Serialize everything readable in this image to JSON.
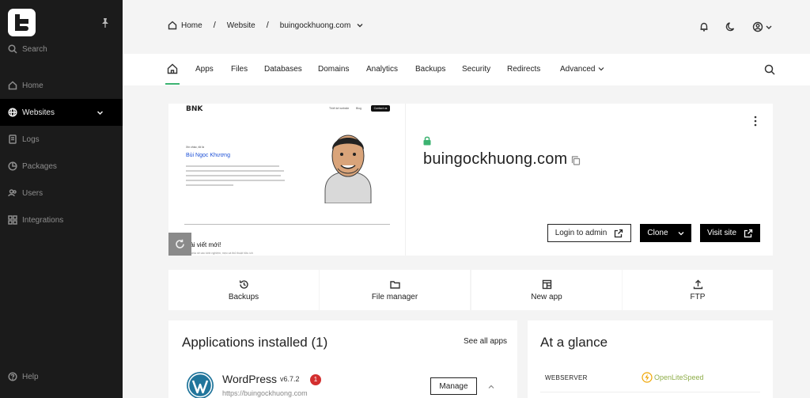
{
  "sidebar": {
    "search_label": "Search",
    "items": [
      {
        "label": "Home"
      },
      {
        "label": "Websites"
      },
      {
        "label": "Logs"
      },
      {
        "label": "Packages"
      },
      {
        "label": "Users"
      },
      {
        "label": "Integrations"
      }
    ],
    "help_label": "Help"
  },
  "breadcrumb": {
    "home": "Home",
    "section": "Website",
    "current": "buingockhuong.com"
  },
  "tabs": [
    "Apps",
    "Files",
    "Databases",
    "Domains",
    "Analytics",
    "Backups",
    "Security",
    "Redirects",
    "Advanced"
  ],
  "site": {
    "domain": "buingockhuong.com",
    "login_button": "Login to admin",
    "clone_button": "Clone",
    "visit_button": "Visit site",
    "preview": {
      "logo_text": "BNK",
      "nav_link_1": "Thiết kế website",
      "nav_link_2": "Blog",
      "nav_button": "Contact us",
      "greeting": "Xin chào, tôi là",
      "name": "Bùi Ngọc Khương",
      "post_heading": "Bài viết mới!",
      "post_sub": "Nơi chia sẻ các kinh nghiệm, mẹo và thủ thuật hữu ích"
    }
  },
  "quick_actions": [
    "Backups",
    "File manager",
    "New app",
    "FTP"
  ],
  "apps_panel": {
    "title": "Applications installed (1)",
    "see_all": "See all apps",
    "app_name": "WordPress",
    "app_version": "v6.7.2",
    "badge_count": "1",
    "app_url": "https://buingockhuong.com",
    "manage_label": "Manage"
  },
  "glance_panel": {
    "title": "At a glance",
    "webserver_label": "WEBSERVER",
    "webserver_value": "OpenLiteSpeed"
  },
  "colors": {
    "sidebar_bg": "#1b1b1b",
    "active_tab_underline": "#3cb371",
    "badge_red": "#d32f2f",
    "lock_green": "#3cb371"
  }
}
